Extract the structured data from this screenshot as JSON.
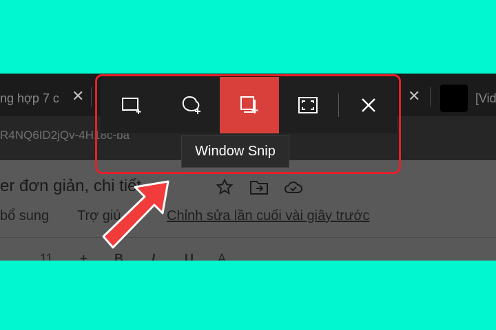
{
  "browser": {
    "tabs": [
      {
        "title": "ng hợp 7 c",
        "close": "✕"
      },
      {
        "close": "✕"
      },
      {
        "title": "[Vid"
      }
    ],
    "url": "R4NQ6ID2jQv-4H18c-ba"
  },
  "document": {
    "title": "er đơn giản, chi tiết",
    "menu": [
      "bổ sung",
      "Trợ giú"
    ],
    "last_edit": "Chỉnh sửa lần cuối vài giây trước",
    "toolbar_fragments": [
      "11",
      "+",
      "B",
      "I",
      "U",
      "A"
    ]
  },
  "snip_toolbar": {
    "buttons": [
      {
        "name": "rectangle-snip",
        "icon": "rectangle-snip-icon",
        "active": false
      },
      {
        "name": "freeform-snip",
        "icon": "freeform-snip-icon",
        "active": false
      },
      {
        "name": "window-snip",
        "icon": "window-snip-icon",
        "active": true
      },
      {
        "name": "fullscreen-snip",
        "icon": "fullscreen-snip-icon",
        "active": false
      },
      {
        "name": "close",
        "icon": "close-icon",
        "active": false
      }
    ],
    "tooltip": "Window Snip",
    "active_color": "#d9403b"
  },
  "annotation": {
    "frame_color": "#e6202a",
    "arrow_color": "#f23b3b"
  },
  "background_color": "#00f7cf"
}
